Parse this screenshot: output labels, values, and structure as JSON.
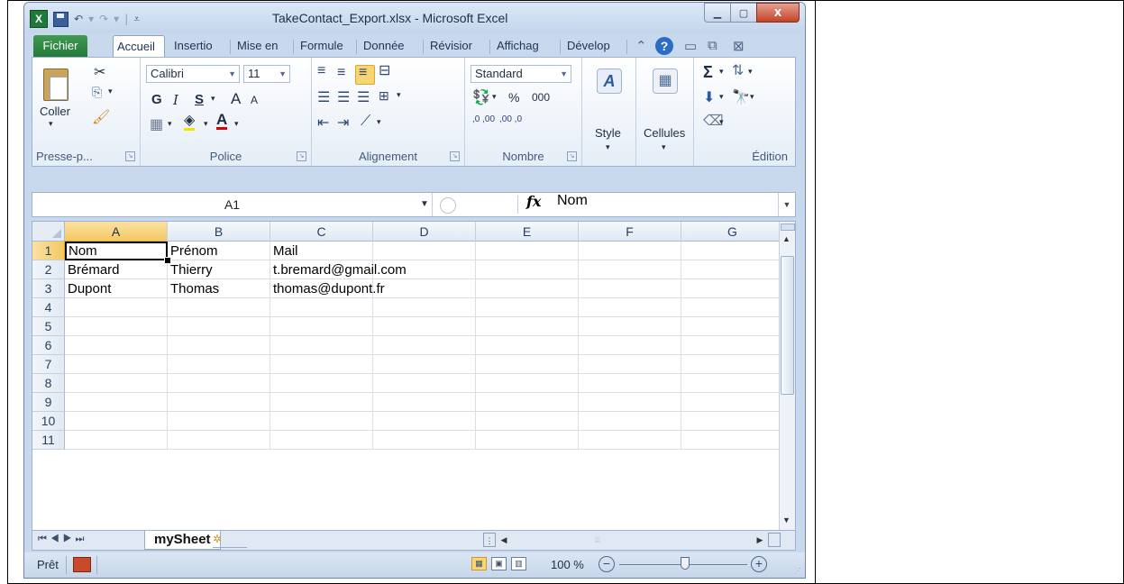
{
  "window": {
    "title": "TakeContact_Export.xlsx - Microsoft Excel",
    "minimize_icon": "minimize-icon",
    "maximize_icon": "maximize-icon",
    "close_label": "X"
  },
  "quick_access": {
    "logo": "X",
    "icons": [
      "save-icon",
      "undo-icon",
      "redo-icon",
      "customize-icon"
    ]
  },
  "tabs": [
    {
      "label": "Fichier"
    },
    {
      "label": "Accueil"
    },
    {
      "label": "Insertio"
    },
    {
      "label": "Mise en"
    },
    {
      "label": "Formule"
    },
    {
      "label": "Donnée"
    },
    {
      "label": "Révisior"
    },
    {
      "label": "Affichag"
    },
    {
      "label": "Dévelop"
    }
  ],
  "ribbon": {
    "clipboard": {
      "paste_label": "Coller",
      "group_label": "Presse-p..."
    },
    "font": {
      "name": "Calibri",
      "size": "11",
      "bold": "G",
      "italic": "I",
      "underline": "S",
      "grow": "A",
      "shrink": "A",
      "group_label": "Police"
    },
    "alignment": {
      "group_label": "Alignement"
    },
    "number": {
      "format": "Standard",
      "percent": "%",
      "thousands": "000",
      "inc_decimal": ",0 ,00",
      "dec_decimal": ",00 ,0",
      "group_label": "Nombre"
    },
    "style": {
      "label": "Style"
    },
    "cells": {
      "label": "Cellules"
    },
    "editing": {
      "sum": "Σ",
      "group_label": "Édition"
    }
  },
  "formula_bar": {
    "name_box": "A1",
    "fx": "fx",
    "value": "Nom"
  },
  "sheet": {
    "columns": [
      "A",
      "B",
      "C",
      "D",
      "E",
      "F",
      "G"
    ],
    "rows": [
      "1",
      "2",
      "3",
      "4",
      "5",
      "6",
      "7",
      "8",
      "9",
      "10",
      "11"
    ],
    "cells": [
      [
        "Nom",
        "Prénom",
        "Mail",
        "",
        "",
        "",
        ""
      ],
      [
        "Brémard",
        "Thierry",
        "t.bremard@gmail.com",
        "",
        "",
        "",
        ""
      ],
      [
        "Dupont",
        "Thomas",
        "thomas@dupont.fr",
        "",
        "",
        "",
        ""
      ]
    ],
    "selected_cell": "A1",
    "tab_name": "mySheet"
  },
  "status": {
    "ready": "Prêt",
    "zoom": "100 %",
    "zoom_minus": "−",
    "zoom_plus": "+"
  }
}
